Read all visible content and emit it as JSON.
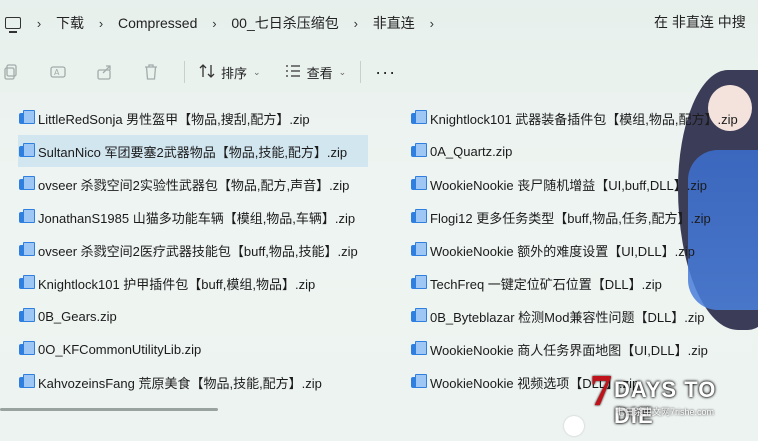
{
  "breadcrumb": {
    "items": [
      "下载",
      "Compressed",
      "00_七日杀压缩包",
      "非直连"
    ]
  },
  "search": {
    "placeholder": "在 非直连 中搜"
  },
  "toolbar": {
    "icons": [
      "copy-icon",
      "rename-icon",
      "share-icon",
      "delete-icon"
    ],
    "sort_label": "排序",
    "view_label": "查看",
    "more_label": "···"
  },
  "files": {
    "left": [
      "LittleRedSonja 男性盔甲【物品,搜刮,配方】.zip",
      "SultanNico 军团要塞2武器物品【物品,技能,配方】.zip",
      "ovseer 杀戮空间2实验性武器包【物品,配方,声音】.zip",
      "JonathanS1985 山猫多功能车辆【模组,物品,车辆】.zip",
      "ovseer 杀戮空间2医疗武器技能包【buff,物品,技能】.zip",
      "Knightlock101 护甲插件包【buff,模组,物品】.zip",
      "0B_Gears.zip",
      "0O_KFCommonUtilityLib.zip",
      "KahvozeinsFang 荒原美食【物品,技能,配方】.zip"
    ],
    "right": [
      "Knightlock101 武器装备插件包【模组,物品,配方】.zip",
      "0A_Quartz.zip",
      "WookieNookie 丧尸随机增益【UI,buff,DLL】.zip",
      "Flogi12 更多任务类型【buff,物品,任务,配方】.zip",
      "WookieNookie 额外的难度设置【UI,DLL】.zip",
      "TechFreq 一键定位矿石位置【DLL】.zip",
      "0B_Byteblazar 检测Mod兼容性问题【DLL】.zip",
      "WookieNookie 商人任务界面地图【UI,DLL】.zip",
      "WookieNookie 视频选项【DLL】.zip"
    ],
    "selected": "SultanNico 军团要塞2武器物品【物品,技能,配方】.zip"
  },
  "watermark": {
    "brand": "DAYS TO DIE",
    "numeral": "7",
    "sub": "七日杀中文网7rishe.com"
  }
}
